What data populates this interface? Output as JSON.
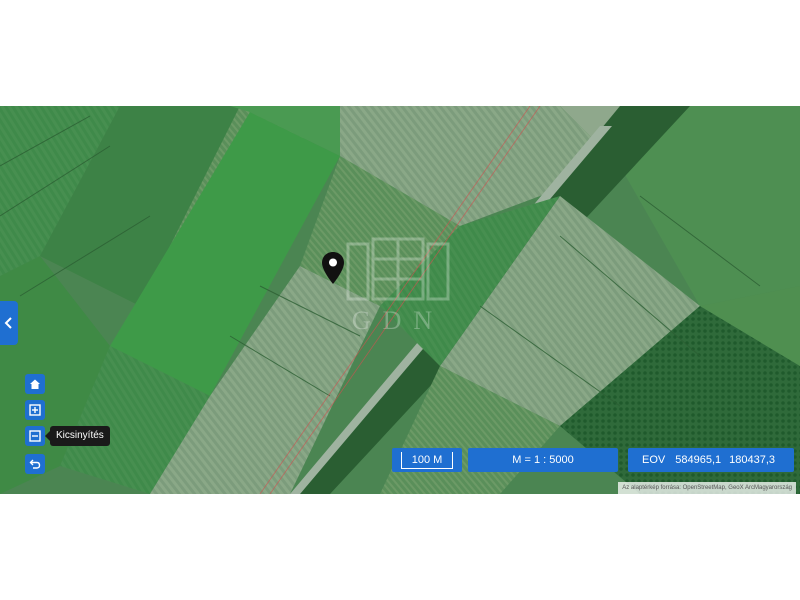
{
  "map": {
    "scale_bar_label": "100 M",
    "scale_ratio": "M = 1 : 5000",
    "coords_system": "EOV",
    "coords_x": "584965,1",
    "coords_y": "180437,3",
    "attribution": "Az alaptérkép forrása: OpenStreetMap, GeoX ArcMagyarország",
    "watermark_text": "GDN"
  },
  "controls": {
    "zoom_out_tooltip": "Kicsinyítés"
  },
  "icons": {
    "sidebar_toggle": "chevron-left-icon",
    "home": "home-icon",
    "zoom_in": "plus-box-icon",
    "zoom_out": "minus-box-icon",
    "back": "undo-icon",
    "marker": "map-pin-icon"
  },
  "colors": {
    "accent": "#1f6fd1",
    "tooltip_bg": "#1a1a1a"
  }
}
